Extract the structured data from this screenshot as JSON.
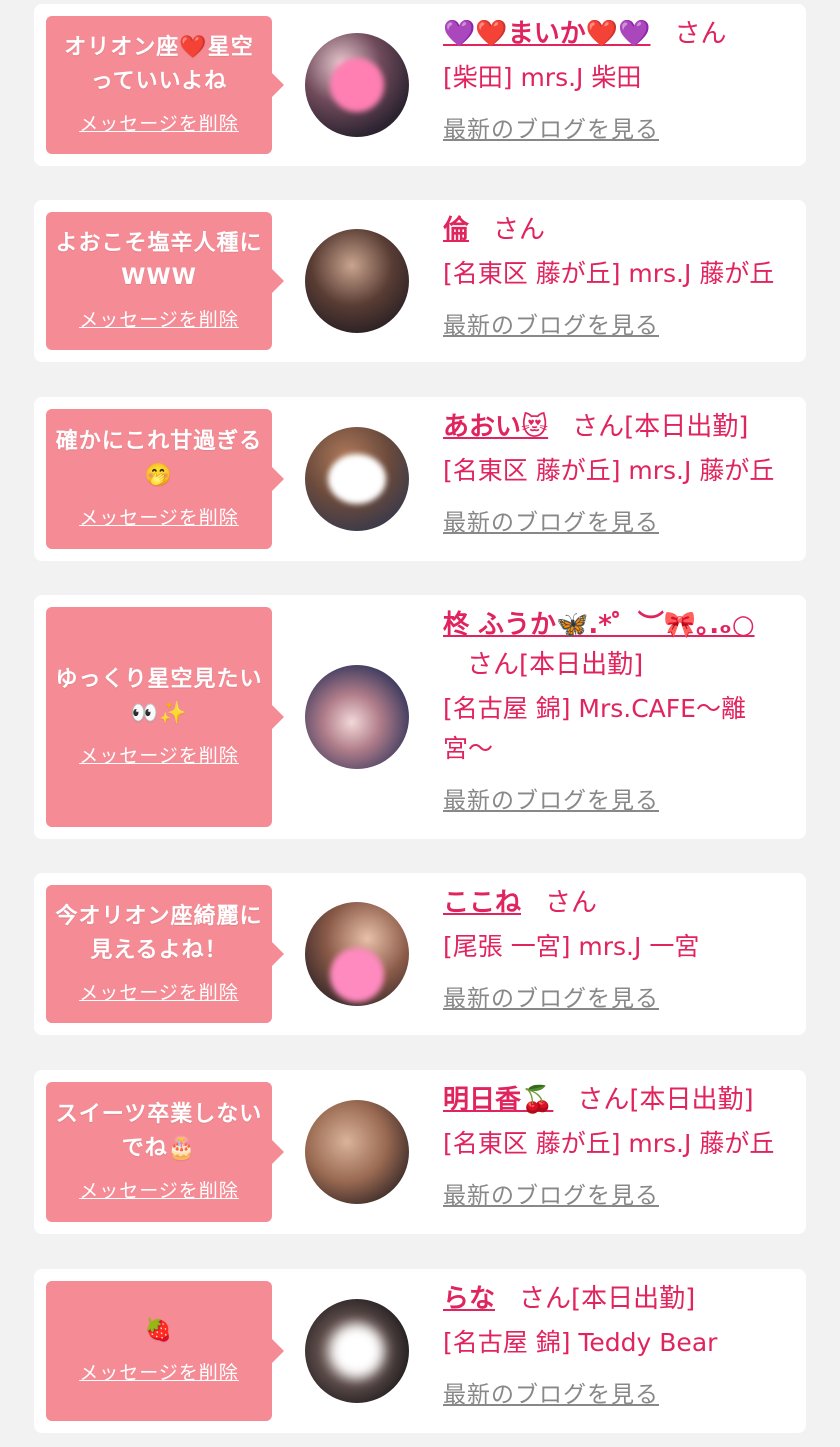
{
  "accent_color": "#e0245e",
  "bubble_color": "#f48b95",
  "messages": [
    {
      "message": "オリオン座❤️星空っていいよね",
      "delete_label": "メッセージを削除",
      "name": "💜❤️まいか❤️💜",
      "honorific": "さん",
      "status": "",
      "shop": "[柴田] mrs.J 柴田",
      "blog_link": "最新のブログを見る"
    },
    {
      "message": "よおこそ塩辛人種にWWW",
      "delete_label": "メッセージを削除",
      "name": "倫",
      "honorific": "さん",
      "status": "",
      "shop": "[名東区 藤が丘] mrs.J 藤が丘",
      "blog_link": "最新のブログを見る"
    },
    {
      "message": "確かにこれ甘過ぎる🤭",
      "delete_label": "メッセージを削除",
      "name": "あおい😻",
      "honorific": "さん",
      "status": "[本日出勤]",
      "shop": "[名東区 藤が丘] mrs.J 藤が丘",
      "blog_link": "最新のブログを見る"
    },
    {
      "message": "ゆっくり星空見たい👀✨",
      "delete_label": "メッセージを削除",
      "name": "柊 ふうか🦋.*゜︶🎀｡.ₒ○",
      "honorific": "さん",
      "status": "[本日出勤]",
      "shop": "[名古屋 錦] Mrs.CAFE〜離宮〜",
      "blog_link": "最新のブログを見る"
    },
    {
      "message": "今オリオン座綺麗に見えるよね！",
      "delete_label": "メッセージを削除",
      "name": "ここね",
      "honorific": "さん",
      "status": "",
      "shop": "[尾張 一宮] mrs.J 一宮",
      "blog_link": "最新のブログを見る"
    },
    {
      "message": "スイーツ卒業しないでね🎂",
      "delete_label": "メッセージを削除",
      "name": "明日香🍒",
      "honorific": "さん",
      "status": "[本日出勤]",
      "shop": "[名東区 藤が丘] mrs.J 藤が丘",
      "blog_link": "最新のブログを見る"
    },
    {
      "message": "🍓",
      "delete_label": "メッセージを削除",
      "name": "らな",
      "honorific": "さん",
      "status": "[本日出勤]",
      "shop": "[名古屋 錦] Teddy Bear",
      "blog_link": "最新のブログを見る"
    }
  ]
}
